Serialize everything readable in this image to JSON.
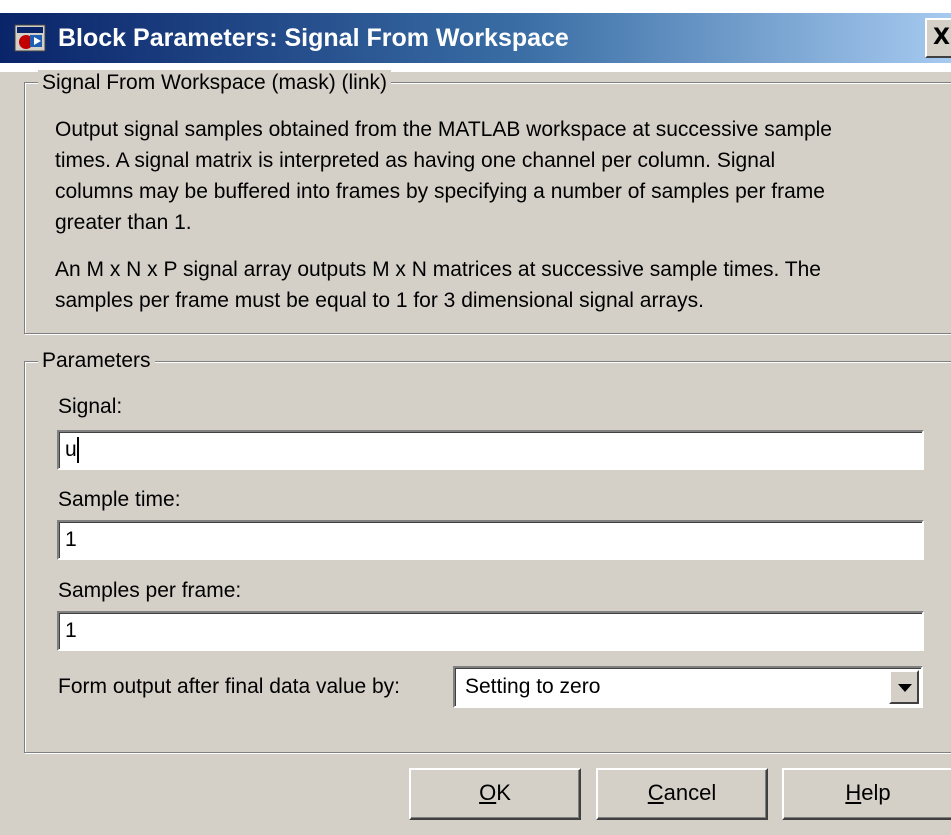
{
  "window": {
    "title": "Block Parameters: Signal From Workspace",
    "close_glyph": "X",
    "icon": "simulink-block-icon"
  },
  "mask_group": {
    "legend": "Signal From Workspace (mask) (link)",
    "description_lines": [
      "Output signal samples obtained from the MATLAB workspace at successive sample",
      "times.  A signal matrix is interpreted as having one channel per column.  Signal",
      "columns may be buffered into frames by specifying a number of samples per frame",
      "greater than 1.",
      "",
      "An M x N x P signal array outputs M x N matrices at successive sample times.  The",
      "samples per frame must be equal to 1 for 3 dimensional signal arrays."
    ]
  },
  "parameters_group": {
    "legend": "Parameters",
    "signal": {
      "label": "Signal:",
      "value": "u"
    },
    "sample_time": {
      "label": "Sample time:",
      "value": "1"
    },
    "samples_per_frame": {
      "label": "Samples per frame:",
      "value": "1"
    },
    "form_output": {
      "label": "Form output after final data value by:",
      "selected": "Setting to zero"
    }
  },
  "buttons": {
    "ok": {
      "mnemonic": "O",
      "rest": "K"
    },
    "cancel": {
      "mnemonic": "C",
      "rest": "ancel"
    },
    "help": {
      "mnemonic": "H",
      "rest": "elp"
    }
  },
  "colors": {
    "face": "#d4d0c8",
    "title_start": "#0a246a",
    "title_end": "#a6caf0"
  }
}
